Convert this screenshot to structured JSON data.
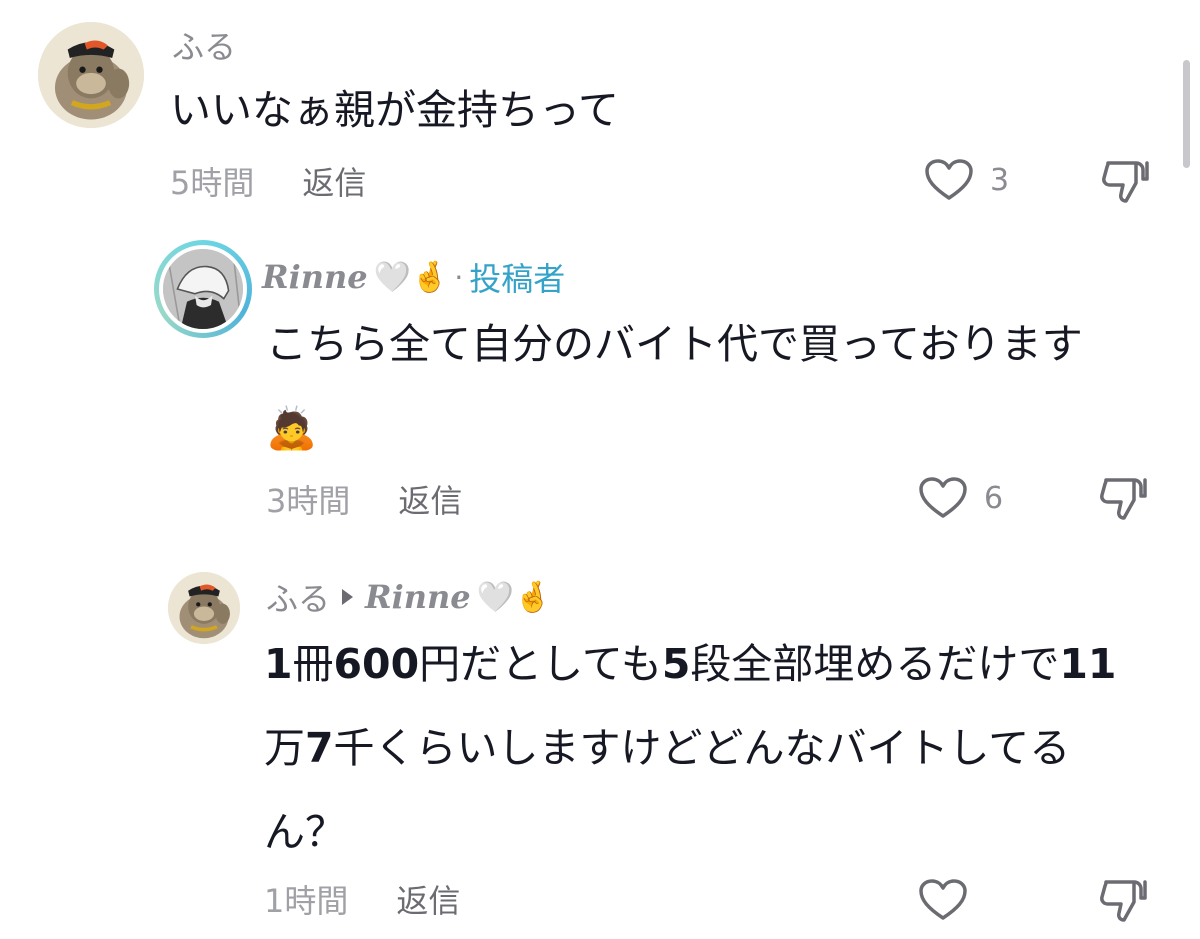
{
  "comments": [
    {
      "username": "ふる",
      "text_lines": [
        "いいなぁ親が金持ちって"
      ],
      "time": "5時間",
      "reply_label": "返信",
      "likes": "3"
    },
    {
      "username": "Rinne",
      "username_emojis": "🤍🤞",
      "author_badge": "投稿者",
      "separator": "·",
      "text_lines": [
        "こちら全て自分のバイト代で買っております",
        "🙇"
      ],
      "time": "3時間",
      "reply_label": "返信",
      "likes": "6"
    },
    {
      "username": "ふる",
      "reply_to": "Rinne",
      "reply_to_emojis": "🤍🤞",
      "text_lines": [
        "1冊600円だとしても5段全部埋めるだけで11",
        "万7千くらいしますけどどんなバイトしてる",
        "ん？"
      ],
      "time": "1時間",
      "reply_label": "返信",
      "likes": ""
    }
  ],
  "colors": {
    "text": "#161823",
    "muted": "#8a8b91",
    "author_badge": "#35a3c9"
  },
  "icons": [
    "avatar-gorilla",
    "avatar-anime-photo",
    "heart-outline-icon",
    "dislike-icon"
  ]
}
